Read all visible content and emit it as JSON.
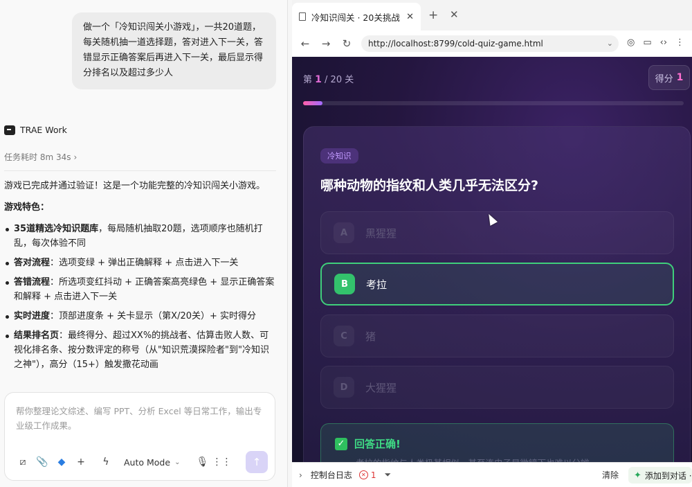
{
  "chat": {
    "user_message": "做一个「冷知识闯关小游戏」，一共20道题，每关随机抽一道选择题，答对进入下一关，答错显示正确答案后再进入下一关，最后显示得分排名以及超过多少人",
    "agent_name": "TRAE Work",
    "task_time": "任务耗时 8m 34s",
    "reply_intro": "游戏已完成并通过验证！这是一个功能完整的冷知识闯关小游戏。",
    "features_heading": "游戏特色：",
    "features": [
      {
        "title": "35道精选冷知识题库",
        "text": "，每局随机抽取20题，选项顺序也随机打乱，每次体验不同"
      },
      {
        "title": "答对流程",
        "text": "：选项变绿 + 弹出正确解释 + 点击进入下一关"
      },
      {
        "title": "答错流程",
        "text": "：所选项变红抖动 + 正确答案高亮绿色 + 显示正确答案和解释 + 点击进入下一关"
      },
      {
        "title": "实时进度",
        "text": "：顶部进度条 + 关卡显示（第X/20关）+ 实时得分"
      },
      {
        "title": "结果排名页",
        "text": "：最终得分、超过XX%的挑战者、估算击败人数、可视化排名条、按分数评定的称号（从\"知识荒漠探险者\"到\"冷知识之神\"），高分（15+）触发撒花动画"
      }
    ],
    "composer_placeholder": "帮你整理论文综述、编写 PPT、分析 Excel 等日常工作，输出专业级工作成果。",
    "mode_label": "Auto Mode"
  },
  "browser": {
    "tab_title": "冷知识闯关 · 20关挑战",
    "url": "http://localhost:8799/cold-quiz-game.html"
  },
  "game": {
    "level_prefix": "第",
    "level_current": "1",
    "level_suffix": "/ 20 关",
    "score_label": "得分",
    "score_value": "1",
    "progress": 0.05,
    "category": "冷知识",
    "question": "哪种动物的指纹和人类几乎无法区分?",
    "options": [
      {
        "key": "A",
        "text": "黑猩猩"
      },
      {
        "key": "B",
        "text": "考拉"
      },
      {
        "key": "C",
        "text": "猪"
      },
      {
        "key": "D",
        "text": "大猩猩"
      }
    ],
    "correct_key": "B",
    "feedback_title": "回答正确!",
    "feedback_text": "考拉的指纹与人类极其相似，甚至连电子显微镜下也难以分辨"
  },
  "console": {
    "label": "控制台日志",
    "error_count": "1",
    "clear_label": "清除",
    "add_label": "添加到对话 ·"
  },
  "colors": {
    "accent": "#e06bd4",
    "correct": "#3fcf7b",
    "send_button": "#d9d4f7"
  }
}
